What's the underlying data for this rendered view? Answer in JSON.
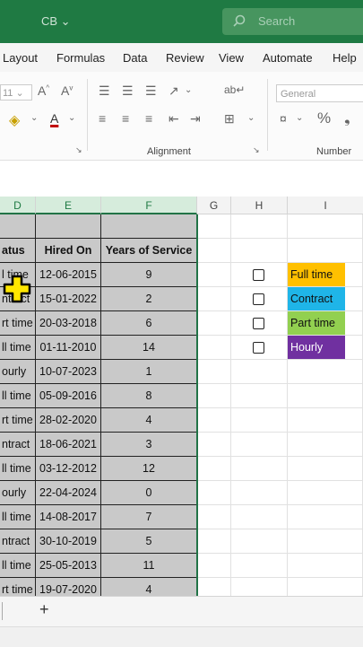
{
  "titlebar": {
    "doc_name": "CB",
    "search_placeholder": "Search"
  },
  "menu": [
    "Layout",
    "Formulas",
    "Data",
    "Review",
    "View",
    "Automate",
    "Help"
  ],
  "ribbon": {
    "font_size": "11",
    "number_format": "General",
    "alignment_label": "Alignment",
    "number_label": "Number"
  },
  "columns": [
    {
      "id": "D",
      "label": "D"
    },
    {
      "id": "E",
      "label": "E"
    },
    {
      "id": "F",
      "label": "F"
    },
    {
      "id": "G",
      "label": "G"
    },
    {
      "id": "H",
      "label": "H"
    },
    {
      "id": "I",
      "label": "I"
    }
  ],
  "table": {
    "headers": [
      "atus",
      "Hired On",
      "Years of Service"
    ],
    "rows": [
      [
        "l time",
        "12-06-2015",
        "9"
      ],
      [
        "ntract",
        "15-01-2022",
        "2"
      ],
      [
        "rt time",
        "20-03-2018",
        "6"
      ],
      [
        "ll time",
        "01-11-2010",
        "14"
      ],
      [
        "ourly",
        "10-07-2023",
        "1"
      ],
      [
        "ll time",
        "05-09-2016",
        "8"
      ],
      [
        "rt time",
        "28-02-2020",
        "4"
      ],
      [
        "ntract",
        "18-06-2021",
        "3"
      ],
      [
        "ll time",
        "03-12-2012",
        "12"
      ],
      [
        "ourly",
        "22-04-2024",
        "0"
      ],
      [
        "ll time",
        "14-08-2017",
        "7"
      ],
      [
        "ntract",
        "30-10-2019",
        "5"
      ],
      [
        "ll time",
        "25-05-2013",
        "11"
      ],
      [
        "rt time",
        "19-07-2020",
        "4"
      ]
    ]
  },
  "legend": [
    {
      "label": "Full time",
      "color": "#ffc000",
      "text_color": "#111111"
    },
    {
      "label": "Contract",
      "color": "#1fb5e8",
      "text_color": "#111111"
    },
    {
      "label": "Part time",
      "color": "#92d050",
      "text_color": "#111111"
    },
    {
      "label": "Hourly",
      "color": "#7030a0",
      "text_color": "#ffffff"
    }
  ],
  "sheet_tabs": {
    "add_label": "+"
  },
  "colors": {
    "accent": "#1f7a43",
    "selection_fill": "#c9c9c9"
  }
}
